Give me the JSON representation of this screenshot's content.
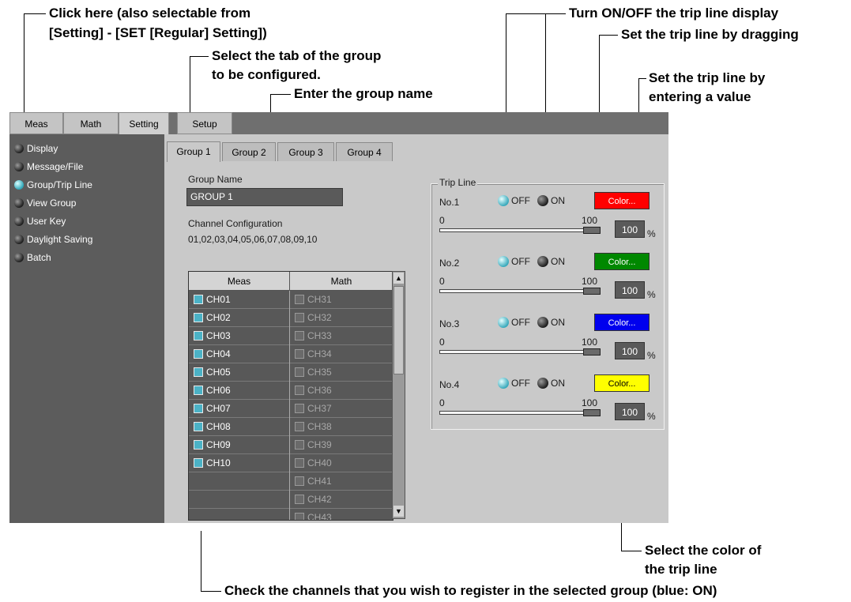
{
  "annotations": {
    "click_here_line1": "Click here (also selectable from",
    "click_here_line2": "[Setting] - [SET [Regular] Setting])",
    "select_tab_line1": "Select the tab of the group",
    "select_tab_line2": "to be configured.",
    "enter_group_name": "Enter the group name",
    "turn_onoff": "Turn ON/OFF the trip line display",
    "set_by_dragging": "Set the trip line by dragging",
    "set_by_value_line1": "Set the trip line by",
    "set_by_value_line2": "entering a value",
    "select_color_line1": "Select the color of",
    "select_color_line2": "the trip line",
    "check_channels": "Check the channels that you wish to register in the selected group (blue: ON)"
  },
  "top_tabs": [
    "Meas",
    "Math",
    "Setting",
    "Setup"
  ],
  "sidebar": {
    "items": [
      {
        "label": "Display",
        "active": false
      },
      {
        "label": "Message/File",
        "active": false
      },
      {
        "label": "Group/Trip Line",
        "active": true
      },
      {
        "label": "View Group",
        "active": false
      },
      {
        "label": "User Key",
        "active": false
      },
      {
        "label": "Daylight Saving",
        "active": false
      },
      {
        "label": "Batch",
        "active": false
      }
    ]
  },
  "group_tabs": [
    "Group 1",
    "Group 2",
    "Group 3",
    "Group 4"
  ],
  "group_name": {
    "label": "Group Name",
    "value": "GROUP 1"
  },
  "channel_config": {
    "label": "Channel Configuration",
    "value": "01,02,03,04,05,06,07,08,09,10"
  },
  "table": {
    "headers": [
      "Meas",
      "Math"
    ],
    "rows": [
      {
        "meas": "CH01",
        "meas_on": true,
        "math": "CH31"
      },
      {
        "meas": "CH02",
        "meas_on": true,
        "math": "CH32"
      },
      {
        "meas": "CH03",
        "meas_on": true,
        "math": "CH33"
      },
      {
        "meas": "CH04",
        "meas_on": true,
        "math": "CH34"
      },
      {
        "meas": "CH05",
        "meas_on": true,
        "math": "CH35"
      },
      {
        "meas": "CH06",
        "meas_on": true,
        "math": "CH36"
      },
      {
        "meas": "CH07",
        "meas_on": true,
        "math": "CH37"
      },
      {
        "meas": "CH08",
        "meas_on": true,
        "math": "CH38"
      },
      {
        "meas": "CH09",
        "meas_on": true,
        "math": "CH39"
      },
      {
        "meas": "CH10",
        "meas_on": true,
        "math": "CH40"
      },
      {
        "meas": "",
        "meas_on": null,
        "math": "CH41"
      },
      {
        "meas": "",
        "meas_on": null,
        "math": "CH42"
      },
      {
        "meas": "",
        "meas_on": null,
        "math": "CH43"
      }
    ]
  },
  "trip_line": {
    "title": "Trip Line",
    "off_label": "OFF",
    "on_label": "ON",
    "color_label": "Color...",
    "unit": "%",
    "scale_min": "0",
    "scale_max": "100",
    "items": [
      {
        "name": "No.1",
        "color": "#ff0000",
        "text_color": "#ffffff",
        "value": "100",
        "level": 1.0
      },
      {
        "name": "No.2",
        "color": "#008800",
        "text_color": "#ffffff",
        "value": "100",
        "level": 1.0
      },
      {
        "name": "No.3",
        "color": "#0000ee",
        "text_color": "#ffffff",
        "value": "100",
        "level": 1.0
      },
      {
        "name": "No.4",
        "color": "#ffff00",
        "text_color": "#000000",
        "value": "100",
        "level": 1.0
      }
    ]
  }
}
